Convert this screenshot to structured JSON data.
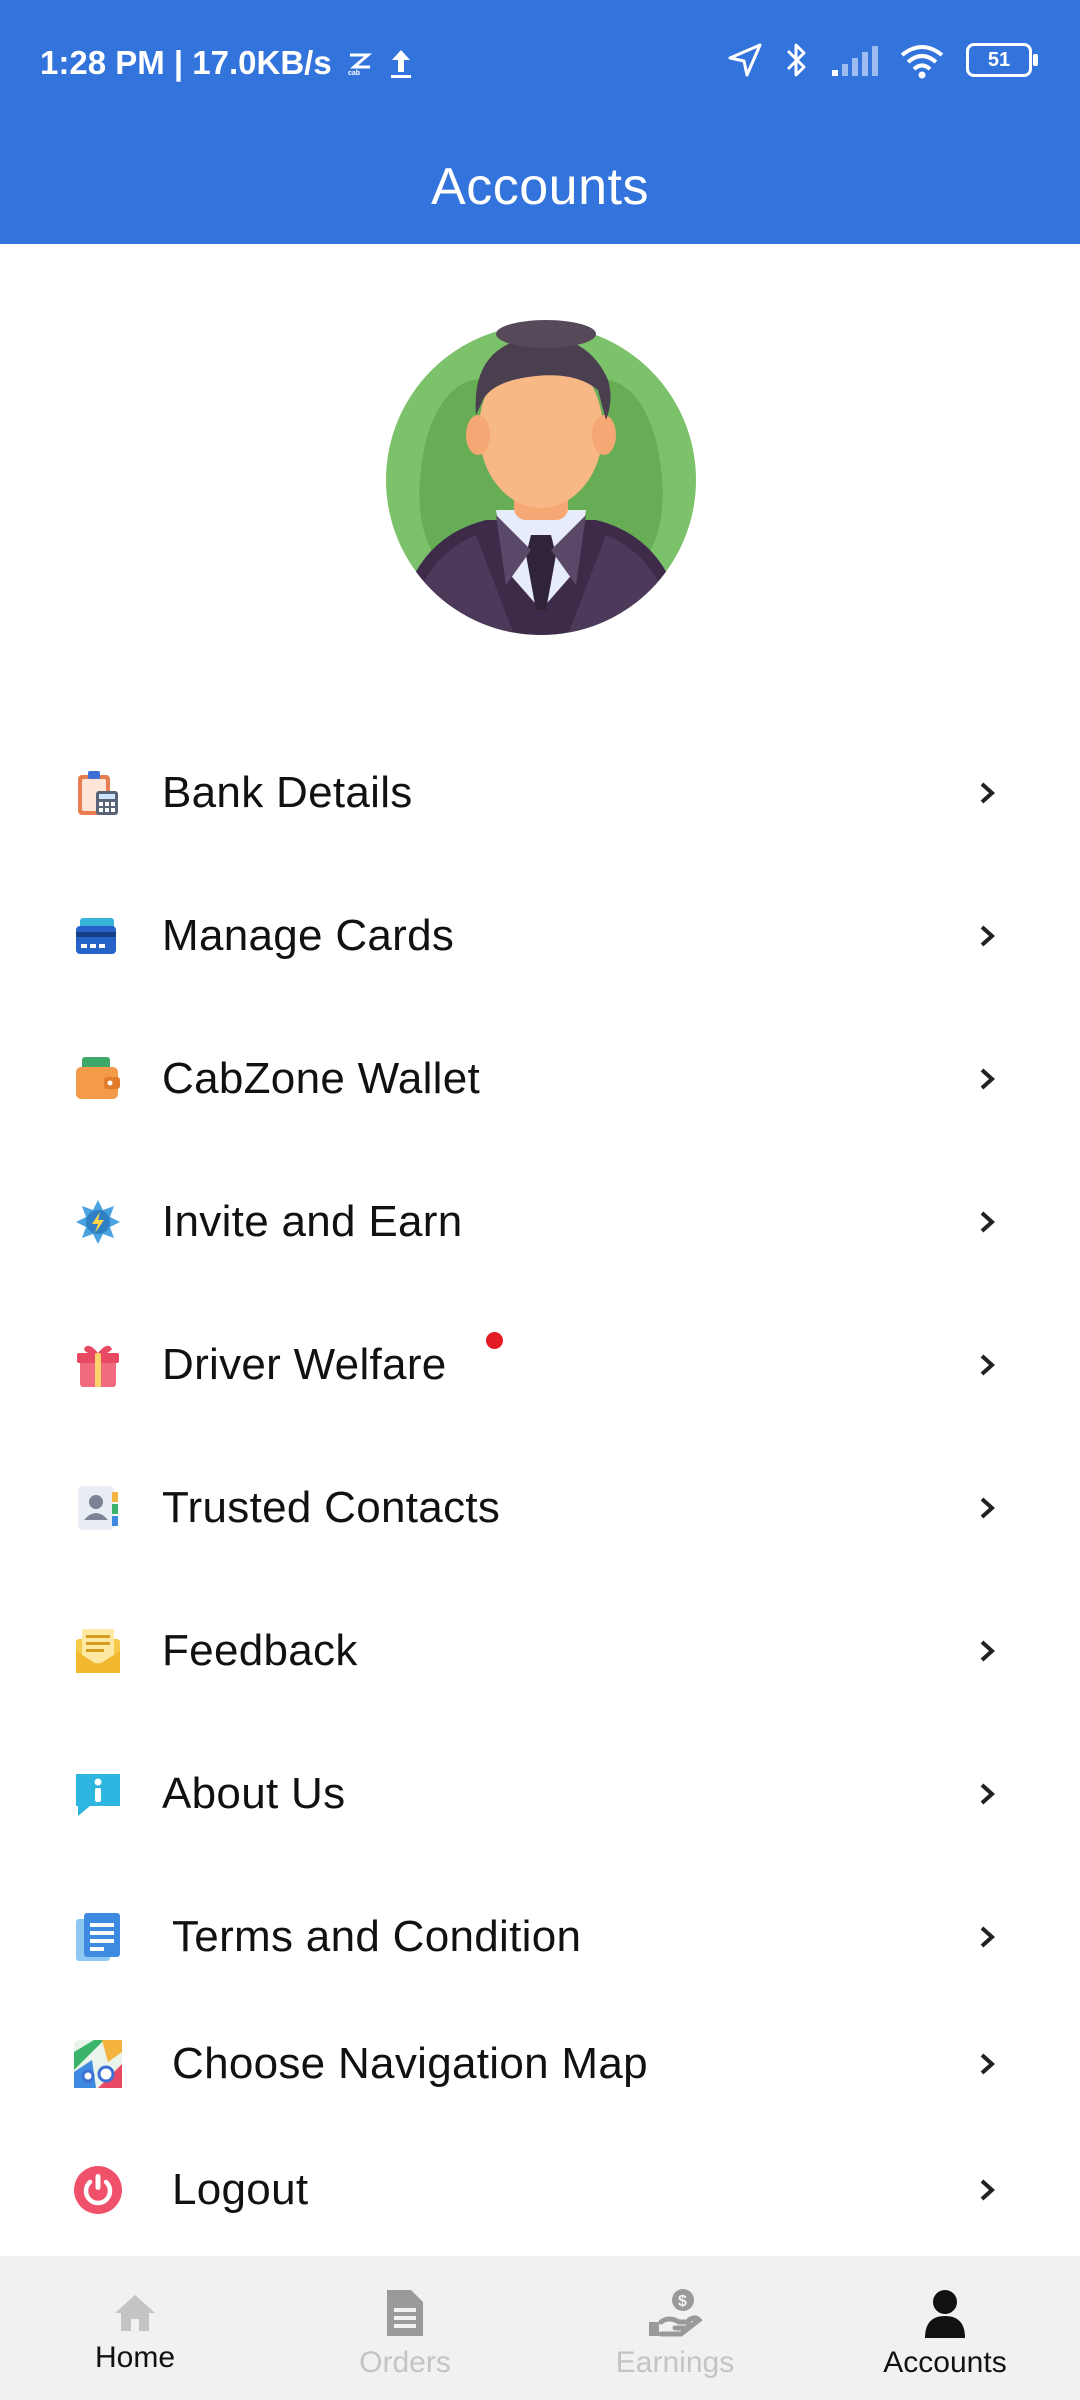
{
  "status_bar": {
    "time_speed": "1:28 PM | 17.0KB/s",
    "battery": "51"
  },
  "header": {
    "title": "Accounts"
  },
  "menu": {
    "items": [
      {
        "label": "Bank Details",
        "icon": "bank-details-icon"
      },
      {
        "label": "Manage Cards",
        "icon": "card-icon"
      },
      {
        "label": "CabZone Wallet",
        "icon": "wallet-icon"
      },
      {
        "label": "Invite and Earn",
        "icon": "invite-icon"
      },
      {
        "label": "Driver Welfare",
        "icon": "gift-icon",
        "badge": true
      },
      {
        "label": "Trusted Contacts",
        "icon": "contacts-icon"
      },
      {
        "label": "Feedback",
        "icon": "feedback-icon"
      },
      {
        "label": "About Us",
        "icon": "info-icon"
      },
      {
        "label": "Terms and Condition",
        "icon": "document-icon"
      },
      {
        "label": "Choose Navigation Map",
        "icon": "map-icon"
      },
      {
        "label": "Logout",
        "icon": "power-icon"
      }
    ]
  },
  "bottom_nav": {
    "tabs": [
      {
        "label": "Home",
        "active": false
      },
      {
        "label": "Orders",
        "active": false
      },
      {
        "label": "Earnings",
        "active": false
      },
      {
        "label": "Accounts",
        "active": true
      }
    ]
  },
  "colors": {
    "brand": "#3273dc",
    "badge": "#e31b23",
    "nav_active": "#111111",
    "nav_inactive": "#c4c4c4"
  }
}
